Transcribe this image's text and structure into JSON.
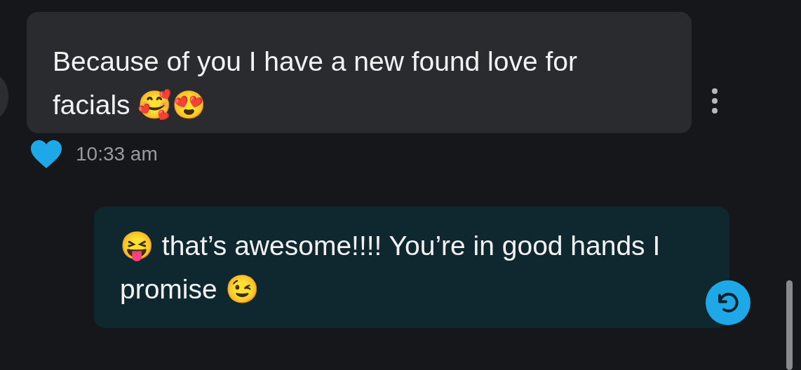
{
  "messages": [
    {
      "kind": "incoming",
      "text": "Because of you I have a new found love for facials 🥰😍",
      "liked": true,
      "time": "10:33 am"
    },
    {
      "kind": "outgoing",
      "text": "😝 that’s awesome!!!! You’re in good hands I promise 😉"
    }
  ]
}
